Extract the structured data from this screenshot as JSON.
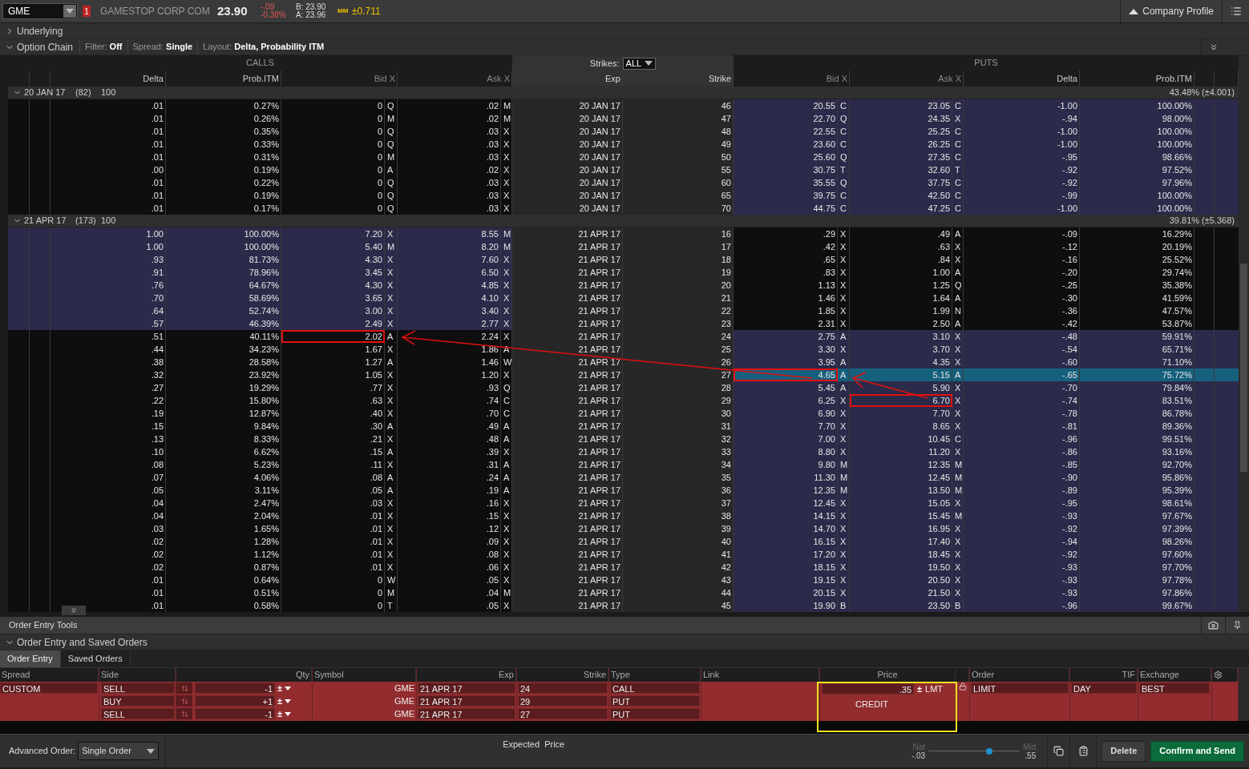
{
  "quote_bar": {
    "symbol": "GME",
    "alert_count": "1",
    "company": "GAMESTOP CORP COM",
    "last": "23.90",
    "change": "-.09",
    "change_pct": "-0.38%",
    "bid": "B: 23.90",
    "ask": "A: 23.96",
    "mm_icon": "MM",
    "expected_move": "±0.711",
    "profile_button": "Company Profile"
  },
  "sections": [
    {
      "label": "Underlying",
      "expanded": false
    },
    {
      "label": "Option Chain",
      "expanded": true
    }
  ],
  "chain_filters": [
    {
      "label": "Filter:",
      "value": "Off"
    },
    {
      "label": "Spread:",
      "value": "Single"
    },
    {
      "label": "Layout:",
      "value": "Delta, Probability ITM"
    }
  ],
  "chain": {
    "calls_title": "CALLS",
    "puts_title": "PUTS",
    "strikes_label": "Strikes:",
    "strikes_value": "ALL",
    "columns": [
      "Delta",
      "Prob.ITM",
      "Bid X",
      "Ask X",
      "Exp",
      "Strike",
      "Bid X",
      "Ask X",
      "Delta",
      "Prob.ITM"
    ],
    "show_arrows": true,
    "groups": [
      {
        "expiry": "20 JAN 17",
        "days": "(82)",
        "multiplier": "100",
        "implied": "43.48% (±4.001)",
        "expanded": true,
        "rows": [
          {
            "cells": [
              ".01",
              "0.27%",
              "0",
              "Q",
              ".02",
              "M",
              "20 JAN 17",
              "46",
              "20.55",
              "C",
              "23.05",
              "C",
              "-1.00",
              "100.00%"
            ],
            "call_itm": false,
            "put_itm": true,
            "selected": false
          },
          {
            "cells": [
              ".01",
              "0.26%",
              "0",
              "M",
              ".02",
              "M",
              "20 JAN 17",
              "47",
              "22.70",
              "Q",
              "24.35",
              "X",
              "-.94",
              "98.00%"
            ],
            "call_itm": false,
            "put_itm": true,
            "selected": false
          },
          {
            "cells": [
              ".01",
              "0.35%",
              "0",
              "Q",
              ".03",
              "X",
              "20 JAN 17",
              "48",
              "22.55",
              "C",
              "25.25",
              "C",
              "-1.00",
              "100.00%"
            ],
            "call_itm": false,
            "put_itm": true,
            "selected": false
          },
          {
            "cells": [
              ".01",
              "0.33%",
              "0",
              "Q",
              ".03",
              "X",
              "20 JAN 17",
              "49",
              "23.60",
              "C",
              "26.25",
              "C",
              "-1.00",
              "100.00%"
            ],
            "call_itm": false,
            "put_itm": true,
            "selected": false
          },
          {
            "cells": [
              ".01",
              "0.31%",
              "0",
              "M",
              ".03",
              "X",
              "20 JAN 17",
              "50",
              "25.60",
              "Q",
              "27.35",
              "C",
              "-.95",
              "98.66%"
            ],
            "call_itm": false,
            "put_itm": true,
            "selected": false
          },
          {
            "cells": [
              ".00",
              "0.19%",
              "0",
              "A",
              ".02",
              "X",
              "20 JAN 17",
              "55",
              "30.75",
              "T",
              "32.60",
              "T",
              "-.92",
              "97.52%"
            ],
            "call_itm": false,
            "put_itm": true,
            "selected": false
          },
          {
            "cells": [
              ".01",
              "0.22%",
              "0",
              "Q",
              ".03",
              "X",
              "20 JAN 17",
              "60",
              "35.55",
              "Q",
              "37.75",
              "C",
              "-.92",
              "97.96%"
            ],
            "call_itm": false,
            "put_itm": true,
            "selected": false
          },
          {
            "cells": [
              ".01",
              "0.19%",
              "0",
              "Q",
              ".03",
              "X",
              "20 JAN 17",
              "65",
              "39.75",
              "C",
              "42.50",
              "C",
              "-.99",
              "100.00%"
            ],
            "call_itm": false,
            "put_itm": true,
            "selected": false
          },
          {
            "cells": [
              ".01",
              "0.17%",
              "0",
              "Q",
              ".03",
              "X",
              "20 JAN 17",
              "70",
              "44.75",
              "C",
              "47.25",
              "C",
              "-1.00",
              "100.00%"
            ],
            "call_itm": false,
            "put_itm": true,
            "selected": false
          }
        ]
      },
      {
        "expiry": "21 APR 17",
        "days": "(173)",
        "multiplier": "100",
        "implied": "39.81% (±5.368)",
        "expanded": true,
        "rows": [
          {
            "cells": [
              "1.00",
              "100.00%",
              "7.20",
              "X",
              "8.55",
              "M",
              "21 APR 17",
              "16",
              ".29",
              "X",
              ".49",
              "A",
              "-.09",
              "16.29%"
            ],
            "call_itm": true,
            "put_itm": false,
            "selected": false
          },
          {
            "cells": [
              "1.00",
              "100.00%",
              "5.40",
              "M",
              "8.20",
              "M",
              "21 APR 17",
              "17",
              ".42",
              "X",
              ".63",
              "X",
              "-.12",
              "20.19%"
            ],
            "call_itm": true,
            "put_itm": false,
            "selected": false
          },
          {
            "cells": [
              ".93",
              "81.73%",
              "4.30",
              "X",
              "7.60",
              "X",
              "21 APR 17",
              "18",
              ".65",
              "X",
              ".84",
              "X",
              "-.16",
              "25.52%"
            ],
            "call_itm": true,
            "put_itm": false,
            "selected": false
          },
          {
            "cells": [
              ".91",
              "78.96%",
              "3.45",
              "X",
              "6.50",
              "X",
              "21 APR 17",
              "19",
              ".83",
              "X",
              "1.00",
              "A",
              "-.20",
              "29.74%"
            ],
            "call_itm": true,
            "put_itm": false,
            "selected": false
          },
          {
            "cells": [
              ".76",
              "64.67%",
              "4.30",
              "X",
              "4.85",
              "X",
              "21 APR 17",
              "20",
              "1.13",
              "X",
              "1.25",
              "Q",
              "-.25",
              "35.38%"
            ],
            "call_itm": true,
            "put_itm": false,
            "selected": false
          },
          {
            "cells": [
              ".70",
              "58.69%",
              "3.65",
              "X",
              "4.10",
              "X",
              "21 APR 17",
              "21",
              "1.46",
              "X",
              "1.64",
              "A",
              "-.30",
              "41.59%"
            ],
            "call_itm": true,
            "put_itm": false,
            "selected": false
          },
          {
            "cells": [
              ".64",
              "52.74%",
              "3.00",
              "X",
              "3.40",
              "X",
              "21 APR 17",
              "22",
              "1.85",
              "X",
              "1.99",
              "N",
              "-.36",
              "47.57%"
            ],
            "call_itm": true,
            "put_itm": false,
            "selected": false
          },
          {
            "cells": [
              ".57",
              "46.39%",
              "2.49",
              "X",
              "2.77",
              "X",
              "21 APR 17",
              "23",
              "2.31",
              "X",
              "2.50",
              "A",
              "-.42",
              "53.87%"
            ],
            "call_itm": true,
            "put_itm": false,
            "selected": false
          },
          {
            "cells": [
              ".51",
              "40.11%",
              "2.02",
              "A",
              "2.24",
              "X",
              "21 APR 17",
              "24",
              "2.75",
              "A",
              "3.10",
              "X",
              "-.48",
              "59.91%"
            ],
            "call_itm": false,
            "put_itm": true,
            "selected": false,
            "call_bid_boxed": true
          },
          {
            "cells": [
              ".44",
              "34.23%",
              "1.67",
              "X",
              "1.86",
              "A",
              "21 APR 17",
              "25",
              "3.30",
              "X",
              "3.70",
              "X",
              "-.54",
              "65.71%"
            ],
            "call_itm": false,
            "put_itm": true,
            "selected": false
          },
          {
            "cells": [
              ".38",
              "28.58%",
              "1.27",
              "A",
              "1.46",
              "W",
              "21 APR 17",
              "26",
              "3.95",
              "A",
              "4.35",
              "X",
              "-.60",
              "71.10%"
            ],
            "call_itm": false,
            "put_itm": true,
            "selected": false
          },
          {
            "cells": [
              ".32",
              "23.92%",
              "1.05",
              "X",
              "1.20",
              "X",
              "21 APR 17",
              "27",
              "4.65",
              "A",
              "5.15",
              "A",
              "-.65",
              "75.72%"
            ],
            "call_itm": false,
            "put_itm": true,
            "selected": true,
            "put_bid_boxed": true
          },
          {
            "cells": [
              ".27",
              "19.29%",
              ".77",
              "X",
              ".93",
              "Q",
              "21 APR 17",
              "28",
              "5.45",
              "A",
              "5.90",
              "X",
              "-.70",
              "79.84%"
            ],
            "call_itm": false,
            "put_itm": true,
            "selected": false
          },
          {
            "cells": [
              ".22",
              "15.80%",
              ".63",
              "X",
              ".74",
              "C",
              "21 APR 17",
              "29",
              "6.25",
              "X",
              "6.70",
              "X",
              "-.74",
              "83.51%"
            ],
            "call_itm": false,
            "put_itm": true,
            "selected": false,
            "put_ask_boxed": true
          },
          {
            "cells": [
              ".19",
              "12.87%",
              ".40",
              "X",
              ".70",
              "C",
              "21 APR 17",
              "30",
              "6.90",
              "X",
              "7.70",
              "X",
              "-.78",
              "86.78%"
            ],
            "call_itm": false,
            "put_itm": true,
            "selected": false
          },
          {
            "cells": [
              ".15",
              "9.84%",
              ".30",
              "A",
              ".49",
              "A",
              "21 APR 17",
              "31",
              "7.70",
              "X",
              "8.65",
              "X",
              "-.81",
              "89.36%"
            ],
            "call_itm": false,
            "put_itm": true,
            "selected": false
          },
          {
            "cells": [
              ".13",
              "8.33%",
              ".21",
              "X",
              ".48",
              "A",
              "21 APR 17",
              "32",
              "7.00",
              "X",
              "10.45",
              "C",
              "-.96",
              "99.51%"
            ],
            "call_itm": false,
            "put_itm": true,
            "selected": false
          },
          {
            "cells": [
              ".10",
              "6.62%",
              ".15",
              "A",
              ".39",
              "X",
              "21 APR 17",
              "33",
              "8.80",
              "X",
              "11.20",
              "X",
              "-.86",
              "93.16%"
            ],
            "call_itm": false,
            "put_itm": true,
            "selected": false
          },
          {
            "cells": [
              ".08",
              "5.23%",
              ".11",
              "X",
              ".31",
              "A",
              "21 APR 17",
              "34",
              "9.80",
              "M",
              "12.35",
              "M",
              "-.85",
              "92.70%"
            ],
            "call_itm": false,
            "put_itm": true,
            "selected": false
          },
          {
            "cells": [
              ".07",
              "4.06%",
              ".08",
              "A",
              ".24",
              "A",
              "21 APR 17",
              "35",
              "11.30",
              "M",
              "12.45",
              "M",
              "-.90",
              "95.86%"
            ],
            "call_itm": false,
            "put_itm": true,
            "selected": false
          },
          {
            "cells": [
              ".05",
              "3.11%",
              ".05",
              "A",
              ".19",
              "A",
              "21 APR 17",
              "36",
              "12.35",
              "M",
              "13.50",
              "M",
              "-.89",
              "95.39%"
            ],
            "call_itm": false,
            "put_itm": true,
            "selected": false
          },
          {
            "cells": [
              ".04",
              "2.47%",
              ".03",
              "X",
              ".16",
              "X",
              "21 APR 17",
              "37",
              "12.45",
              "X",
              "15.05",
              "X",
              "-.95",
              "98.61%"
            ],
            "call_itm": false,
            "put_itm": true,
            "selected": false
          },
          {
            "cells": [
              ".04",
              "2.04%",
              ".01",
              "X",
              ".15",
              "X",
              "21 APR 17",
              "38",
              "14.15",
              "X",
              "15.45",
              "M",
              "-.93",
              "97.67%"
            ],
            "call_itm": false,
            "put_itm": true,
            "selected": false
          },
          {
            "cells": [
              ".03",
              "1.65%",
              ".01",
              "X",
              ".12",
              "X",
              "21 APR 17",
              "39",
              "14.70",
              "X",
              "16.95",
              "X",
              "-.92",
              "97.39%"
            ],
            "call_itm": false,
            "put_itm": true,
            "selected": false
          },
          {
            "cells": [
              ".02",
              "1.28%",
              ".01",
              "X",
              ".09",
              "X",
              "21 APR 17",
              "40",
              "16.15",
              "X",
              "17.40",
              "X",
              "-.94",
              "98.26%"
            ],
            "call_itm": false,
            "put_itm": true,
            "selected": false
          },
          {
            "cells": [
              ".02",
              "1.12%",
              ".01",
              "X",
              ".08",
              "X",
              "21 APR 17",
              "41",
              "17.20",
              "X",
              "18.45",
              "X",
              "-.92",
              "97.60%"
            ],
            "call_itm": false,
            "put_itm": true,
            "selected": false
          },
          {
            "cells": [
              ".02",
              "0.87%",
              ".01",
              "X",
              ".06",
              "X",
              "21 APR 17",
              "42",
              "18.15",
              "X",
              "19.50",
              "X",
              "-.93",
              "97.70%"
            ],
            "call_itm": false,
            "put_itm": true,
            "selected": false
          },
          {
            "cells": [
              ".01",
              "0.64%",
              "0",
              "W",
              ".05",
              "X",
              "21 APR 17",
              "43",
              "19.15",
              "X",
              "20.50",
              "X",
              "-.93",
              "97.78%"
            ],
            "call_itm": false,
            "put_itm": true,
            "selected": false
          },
          {
            "cells": [
              ".01",
              "0.51%",
              "0",
              "M",
              ".04",
              "M",
              "21 APR 17",
              "44",
              "20.15",
              "X",
              "21.50",
              "X",
              "-.93",
              "97.86%"
            ],
            "call_itm": false,
            "put_itm": true,
            "selected": false
          },
          {
            "cells": [
              ".01",
              "0.58%",
              "0",
              "T",
              ".05",
              "X",
              "21 APR 17",
              "45",
              "19.90",
              "B",
              "23.50",
              "B",
              "-.96",
              "99.67%"
            ],
            "call_itm": false,
            "put_itm": true,
            "selected": false
          }
        ]
      }
    ]
  },
  "order_tools": {
    "title": "Order Entry Tools",
    "section": "Order Entry and Saved Orders",
    "section_expanded": true,
    "tabs": [
      {
        "label": "Order Entry",
        "selected": true
      },
      {
        "label": "Saved Orders",
        "selected": false
      }
    ],
    "columns": {
      "spread": "Spread",
      "side": "Side",
      "qty": "Qty",
      "symbol": "Symbol",
      "exp": "Exp",
      "strike": "Strike",
      "type": "Type",
      "link": "Link",
      "price": "Price",
      "order": "Order",
      "tif": "TIF",
      "exchange": "Exchange"
    },
    "spread": "CUSTOM",
    "legs": [
      {
        "side": "SELL",
        "qty": "-1",
        "symbol": "GME",
        "exp": "21 APR 17",
        "strike": "24",
        "type": "CALL"
      },
      {
        "side": "BUY",
        "qty": "+1",
        "symbol": "GME",
        "exp": "21 APR 17",
        "strike": "29",
        "type": "PUT"
      },
      {
        "side": "SELL",
        "qty": "-1",
        "symbol": "GME",
        "exp": "21 APR 17",
        "strike": "27",
        "type": "PUT"
      }
    ],
    "spinner_symbol": "±",
    "price": ".35",
    "price_type": "LMT",
    "price_effect": "CREDIT",
    "price_highlighted": true,
    "order_type": "LIMIT",
    "tif": "DAY",
    "exchange": "BEST",
    "advanced_label": "Advanced Order:",
    "advanced_value": "Single Order",
    "expected": "Expected  Price",
    "nat_label": "Nat",
    "nat_value": "-.03",
    "mid_label": "Mid",
    "mid_value": ".55",
    "slider": {
      "level": 0.67
    },
    "buttons": [
      {
        "label": "Delete",
        "kind": "secondary"
      },
      {
        "label": "Confirm and Send",
        "kind": "primary"
      }
    ]
  }
}
